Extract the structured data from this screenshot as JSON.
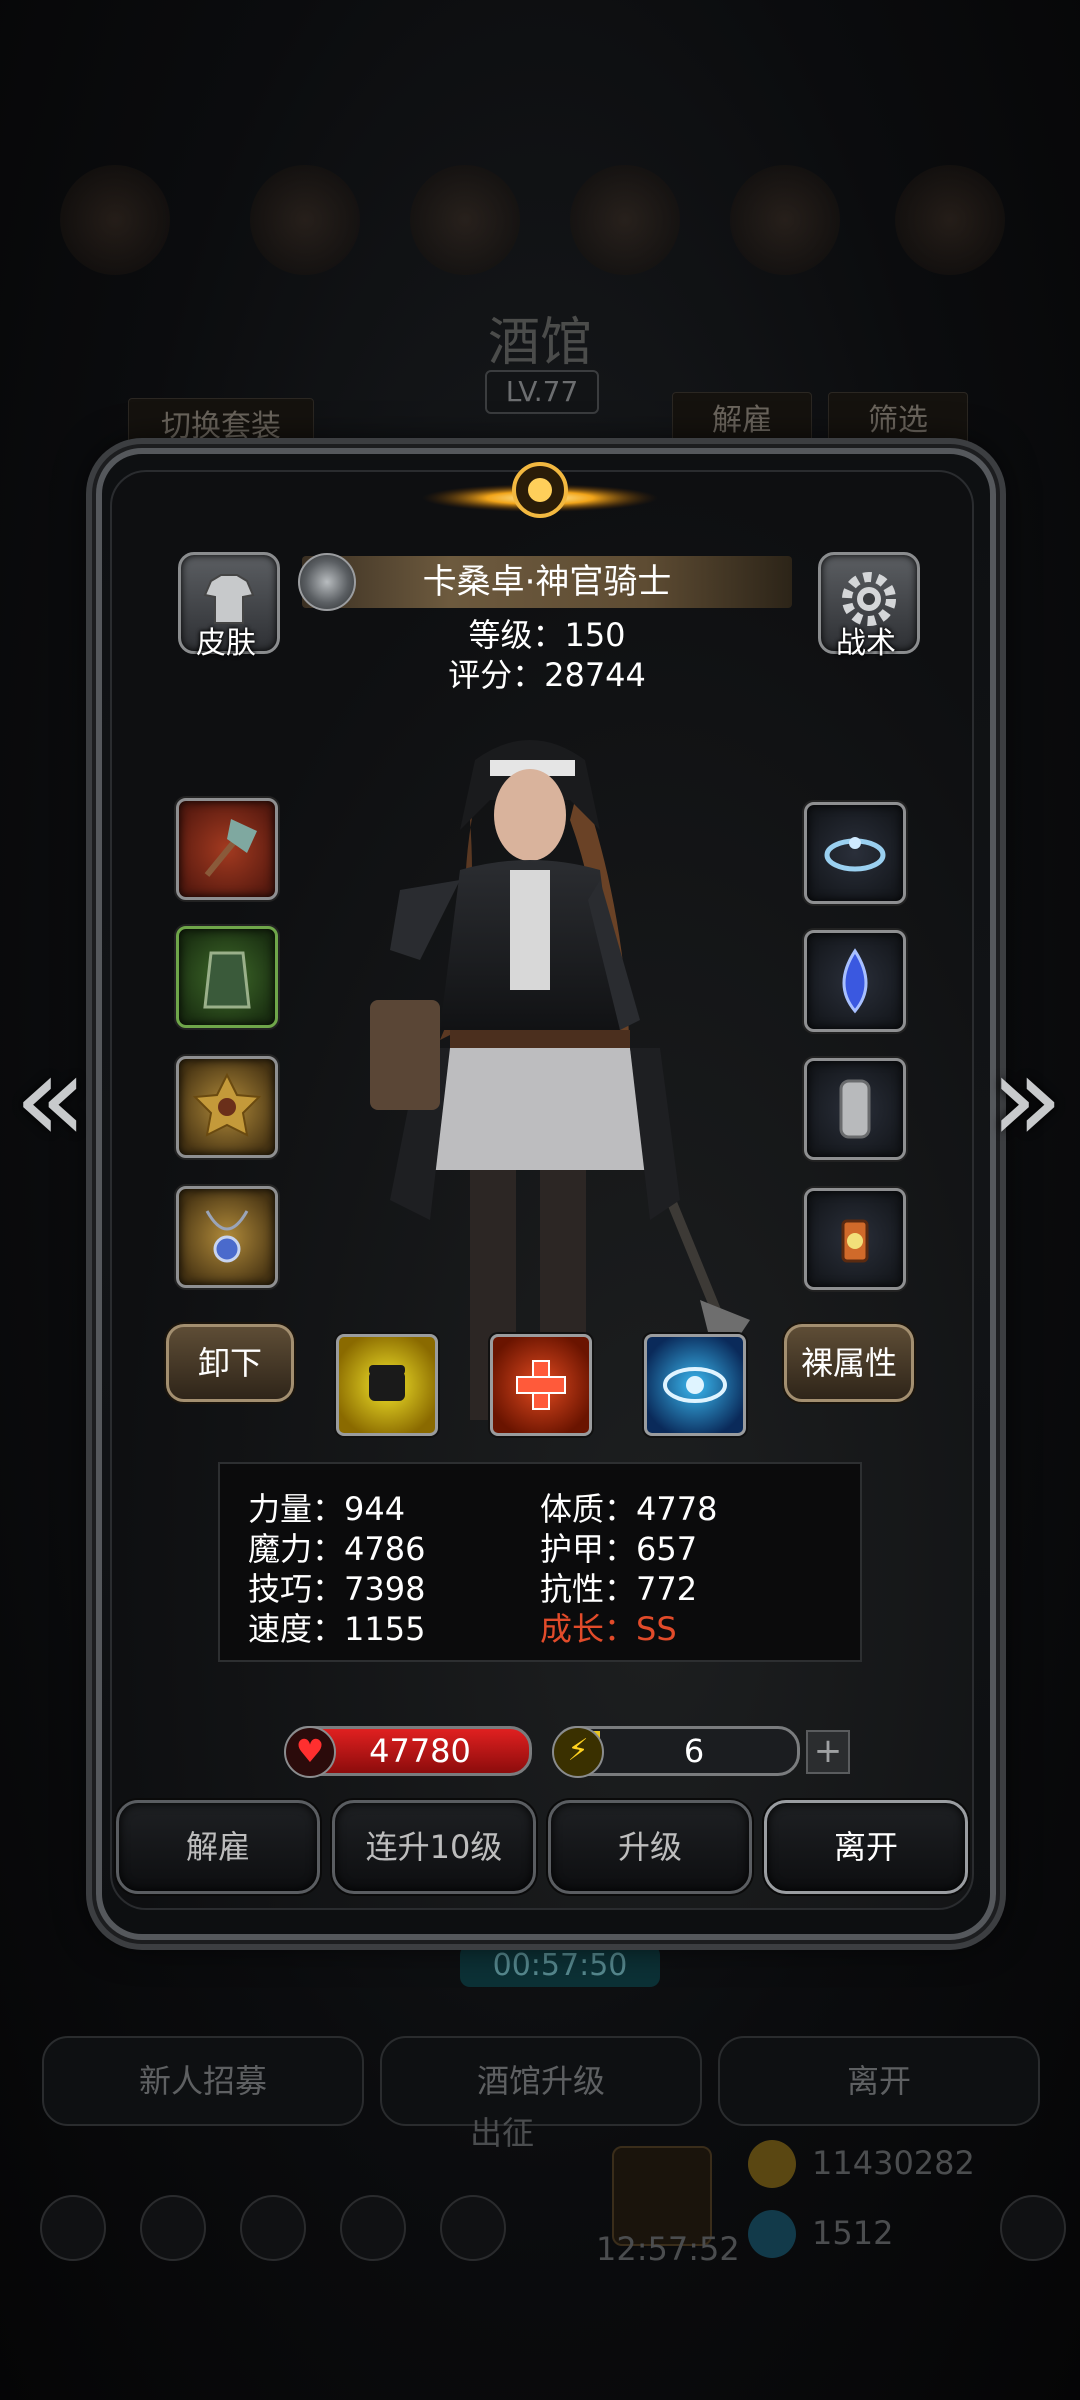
{
  "background": {
    "title": "酒馆",
    "level": "LV.77",
    "switch_outfit": "切换套装",
    "dismiss": "解雇",
    "filter": "筛选",
    "timer": "00:57:50",
    "recruit": "新人招募",
    "tavern_upgrade": "酒馆升级",
    "leave": "离开",
    "expedition": "出征",
    "gold": "11430282",
    "gems": "1512",
    "clock": "12:57:52"
  },
  "hero": {
    "skin_label": "皮肤",
    "tactics_label": "战术",
    "name": "卡桑卓·神官骑士",
    "level_line": "等级：150",
    "score_line": "评分：28744"
  },
  "equipment": {
    "left": [
      "axe-icon",
      "armor-icon",
      "medal-icon",
      "amulet-icon"
    ],
    "right": [
      "tiara-icon",
      "gem-drop-icon",
      "chainmail-icon",
      "lantern-icon"
    ]
  },
  "buttons": {
    "unequip": "卸下",
    "naked_attr": "裸属性"
  },
  "skills": [
    "fist-icon",
    "heal-cross-icon",
    "eye-icon"
  ],
  "stats": {
    "strength": "力量：944",
    "magic": "魔力：4786",
    "skill": "技巧：7398",
    "speed": "速度：1155",
    "constitution": "体质：4778",
    "armor": "护甲：657",
    "resist": "抗性：772",
    "growth": "成长：SS"
  },
  "bars": {
    "hp": "47780",
    "energy": "6",
    "energy_fraction": 0.04
  },
  "actions": {
    "dismiss": "解雇",
    "level10": "连升10级",
    "upgrade": "升级",
    "leave": "离开"
  },
  "colors": {
    "growth": "#e24b2a",
    "hp": "#e02020",
    "energy": "#e8c420"
  }
}
